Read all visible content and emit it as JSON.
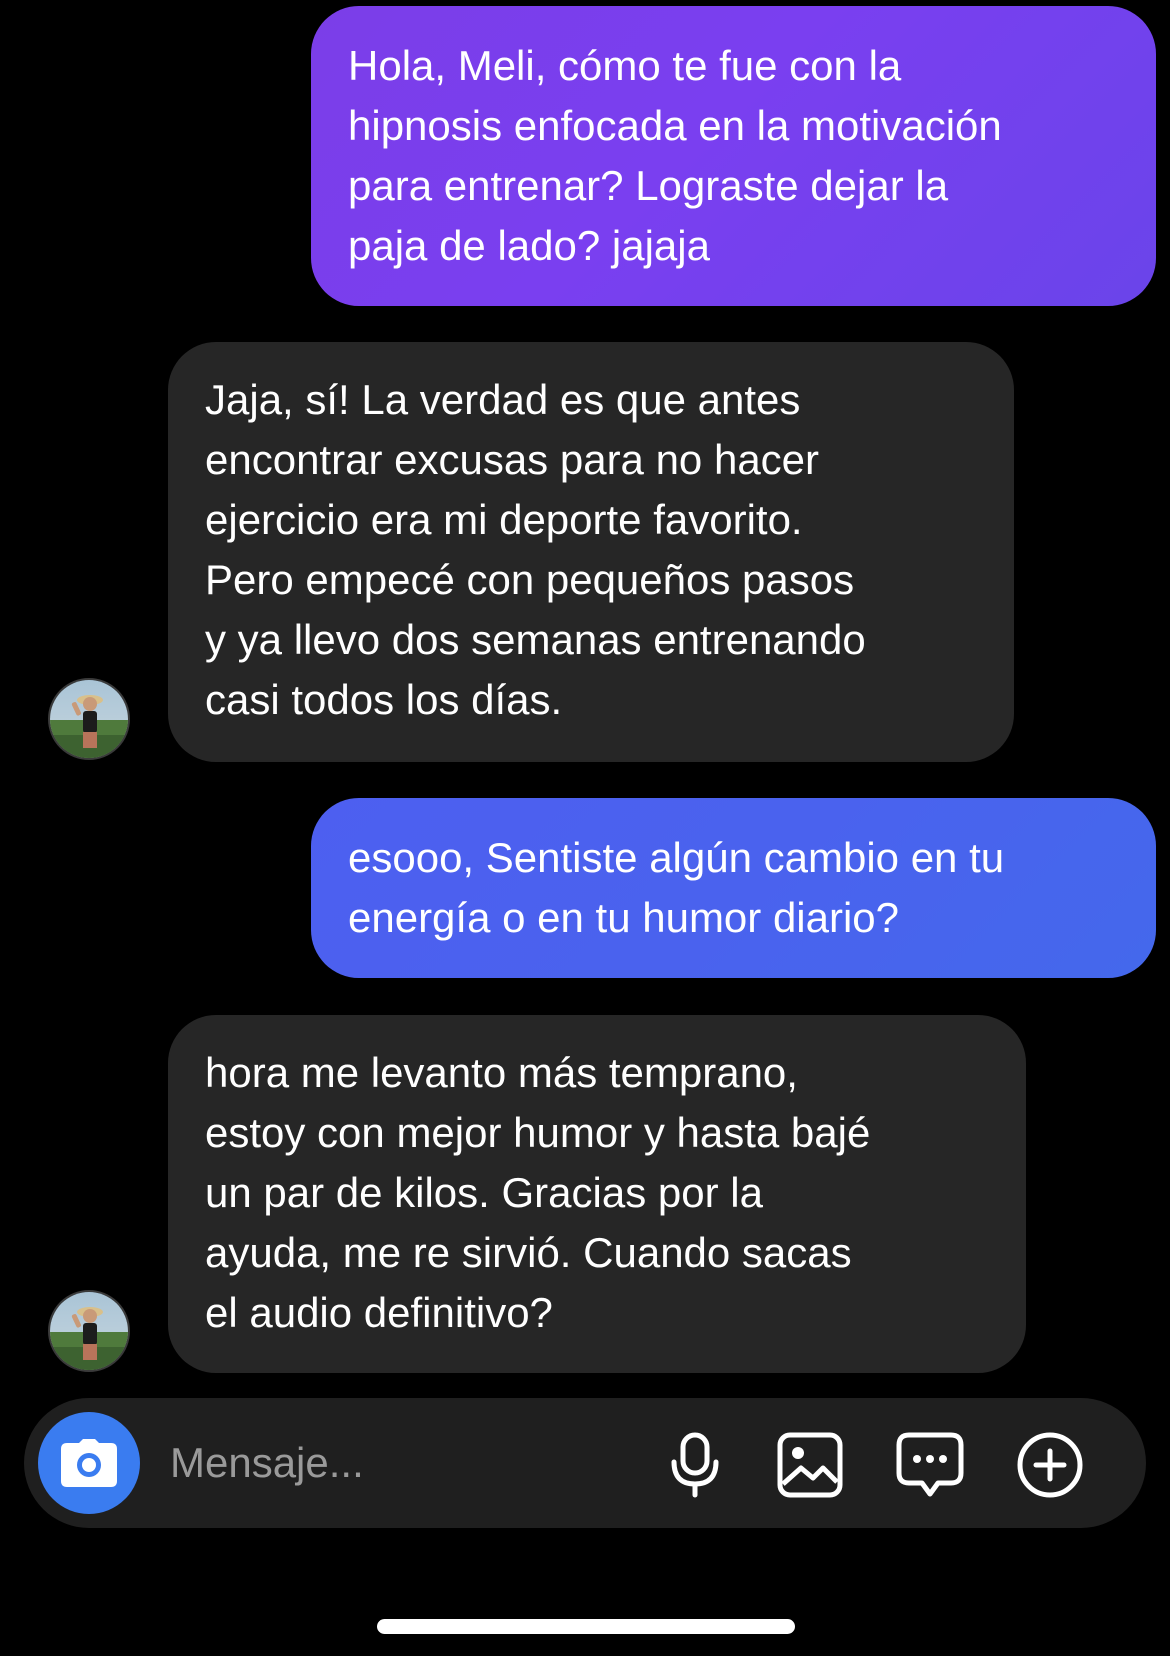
{
  "messages": [
    {
      "direction": "sent",
      "text": "Hola, Meli, cómo te fue con la\nhipnosis enfocada en la motivación\npara entrenar? Lograste dejar la\npaja de lado? jajaja"
    },
    {
      "direction": "received",
      "text": "Jaja, sí! La verdad es que antes\nencontrar excusas para no hacer\nejercicio era mi deporte favorito.\nPero empecé con pequeños pasos\ny ya llevo dos semanas entrenando\ncasi todos los días."
    },
    {
      "direction": "sent",
      "text": "esooo, Sentiste algún cambio en tu\nenergía o en tu humor diario?"
    },
    {
      "direction": "received",
      "text": "hora me levanto más temprano,\nestoy con mejor humor y hasta bajé\nun par de kilos. Gracias por la\nayuda, me re sirvió. Cuando sacas\nel audio definitivo?"
    }
  ],
  "composer": {
    "placeholder": "Mensaje...",
    "value": "",
    "buttons": [
      "camera-icon",
      "microphone-icon",
      "gallery-icon",
      "sticker-icon",
      "add-icon"
    ]
  },
  "colors": {
    "background": "#000000",
    "sent_bubble_1": "#7a3ff0",
    "sent_bubble_2": "#4a62ee",
    "received_bubble": "#262626",
    "composer_background": "#1f1f1f",
    "camera_button": "#3a7cf0",
    "placeholder_text": "#9a9a9a"
  }
}
